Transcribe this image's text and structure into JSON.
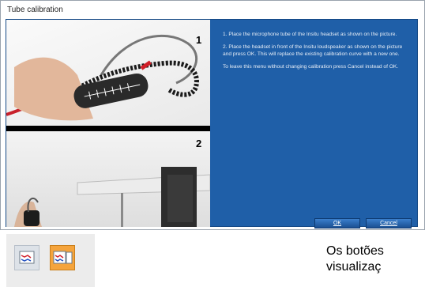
{
  "window": {
    "title": "Tube calibration"
  },
  "pictures": {
    "step1_number": "1",
    "step2_number": "2"
  },
  "instructions": {
    "step1": "1. Place the microphone tube of the Insitu headset as shown on the picture.",
    "step2": "2. Place the headset in front of the Insitu loudspeaker as shown on the picture and press OK. This will replace the existing calibration curve with a new one.",
    "note": "To leave this menu without changing calibration press Cancel instead of OK."
  },
  "buttons": {
    "ok_label": "OK",
    "cancel_label": "Cancel"
  },
  "toolbar": {
    "icons": [
      "audiogram-view-icon",
      "insitu-calibration-icon"
    ]
  },
  "caption": {
    "line1": "Os botões",
    "line2": "visualizaç"
  },
  "colors": {
    "panel_blue": "#1f5fa8",
    "button_blue": "#2a68b0",
    "highlight_orange": "#f5a43c"
  }
}
